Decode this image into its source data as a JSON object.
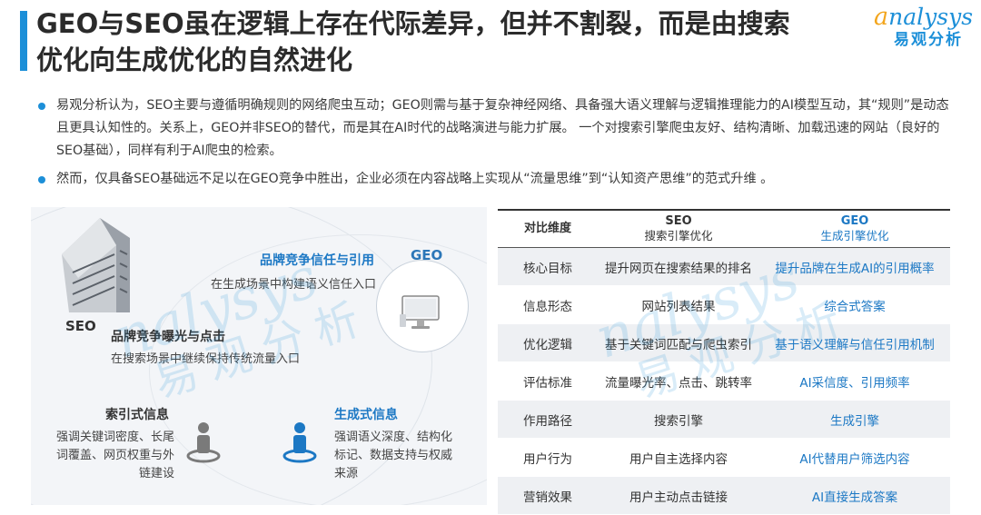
{
  "header": {
    "title_line1": "GEO与SEO虽在逻辑上存在代际差异，但并不割裂，而是由搜索",
    "title_line2": "优化向生成优化的自然进化",
    "logo_en": "nalysys",
    "logo_cn": "易观分析"
  },
  "bullets": [
    "易观分析认为，SEO主要与遵循明确规则的网络爬虫互动；GEO则需与基于复杂神经网络、具备强大语义理解与逻辑推理能力的AI模型互动，其“规则”是动态且更具认知性的。关系上，GEO并非SEO的替代，而是其在AI时代的战略演进与能力扩展。 一个对搜索引擎爬虫友好、结构清晰、加载迅速的网站（良好的SEO基础），同样有利于AI爬虫的检索。",
    "然而，仅具备SEO基础远不足以在GEO竞争中胜出，企业必须在内容战略上实现从“流量思维”到“认知资产思维”的范式升维 。"
  ],
  "diagram": {
    "seo_label": "SEO",
    "geo_label": "GEO",
    "brand_trust_title": "品牌竞争信任与引用",
    "brand_trust_sub": "在生成场景中构建语义信任入口",
    "brand_exposure_title": "品牌竞争曝光与点击",
    "brand_exposure_sub": "在搜索场景中继续保持传统流量入口",
    "index_title": "索引式信息",
    "index_desc": "强调关键词密度、长尾词覆盖、网页权重与外链建设",
    "gen_title": "生成式信息",
    "gen_desc": "强调语义深度、结构化标记、数据支持与权威来源"
  },
  "watermark": {
    "en": "nalysys",
    "cn": "易观分析"
  },
  "table": {
    "head_dim": "对比维度",
    "head_seo": "SEO",
    "head_seo_sub": "搜索引擎优化",
    "head_geo": "GEO",
    "head_geo_sub": "生成引擎优化",
    "rows": [
      {
        "dim": "核心目标",
        "seo": "提升网页在搜索结果的排名",
        "geo": "提升品牌在生成AI的引用概率"
      },
      {
        "dim": "信息形态",
        "seo": "网站列表结果",
        "geo": "综合式答案"
      },
      {
        "dim": "优化逻辑",
        "seo": "基于关键词匹配与爬虫索引",
        "geo": "基于语义理解与信任引用机制"
      },
      {
        "dim": "评估标准",
        "seo": "流量曝光率、点击、跳转率",
        "geo": "AI采信度、引用频率"
      },
      {
        "dim": "作用路径",
        "seo": "搜索引擎",
        "geo": "生成引擎"
      },
      {
        "dim": "用户行为",
        "seo": "用户自主选择内容",
        "geo": "AI代替用户筛选内容"
      },
      {
        "dim": "营销效果",
        "seo": "用户主动点击链接",
        "geo": "AI直接生成答案"
      }
    ]
  },
  "colors": {
    "accent": "#1c8fd8",
    "logo_orange": "#f3a51c",
    "geo_text": "#1c78c4"
  },
  "icons": [
    "analysys-logo",
    "building-image",
    "monitor-icon",
    "person-pin-gray-icon",
    "person-pin-blue-icon"
  ]
}
